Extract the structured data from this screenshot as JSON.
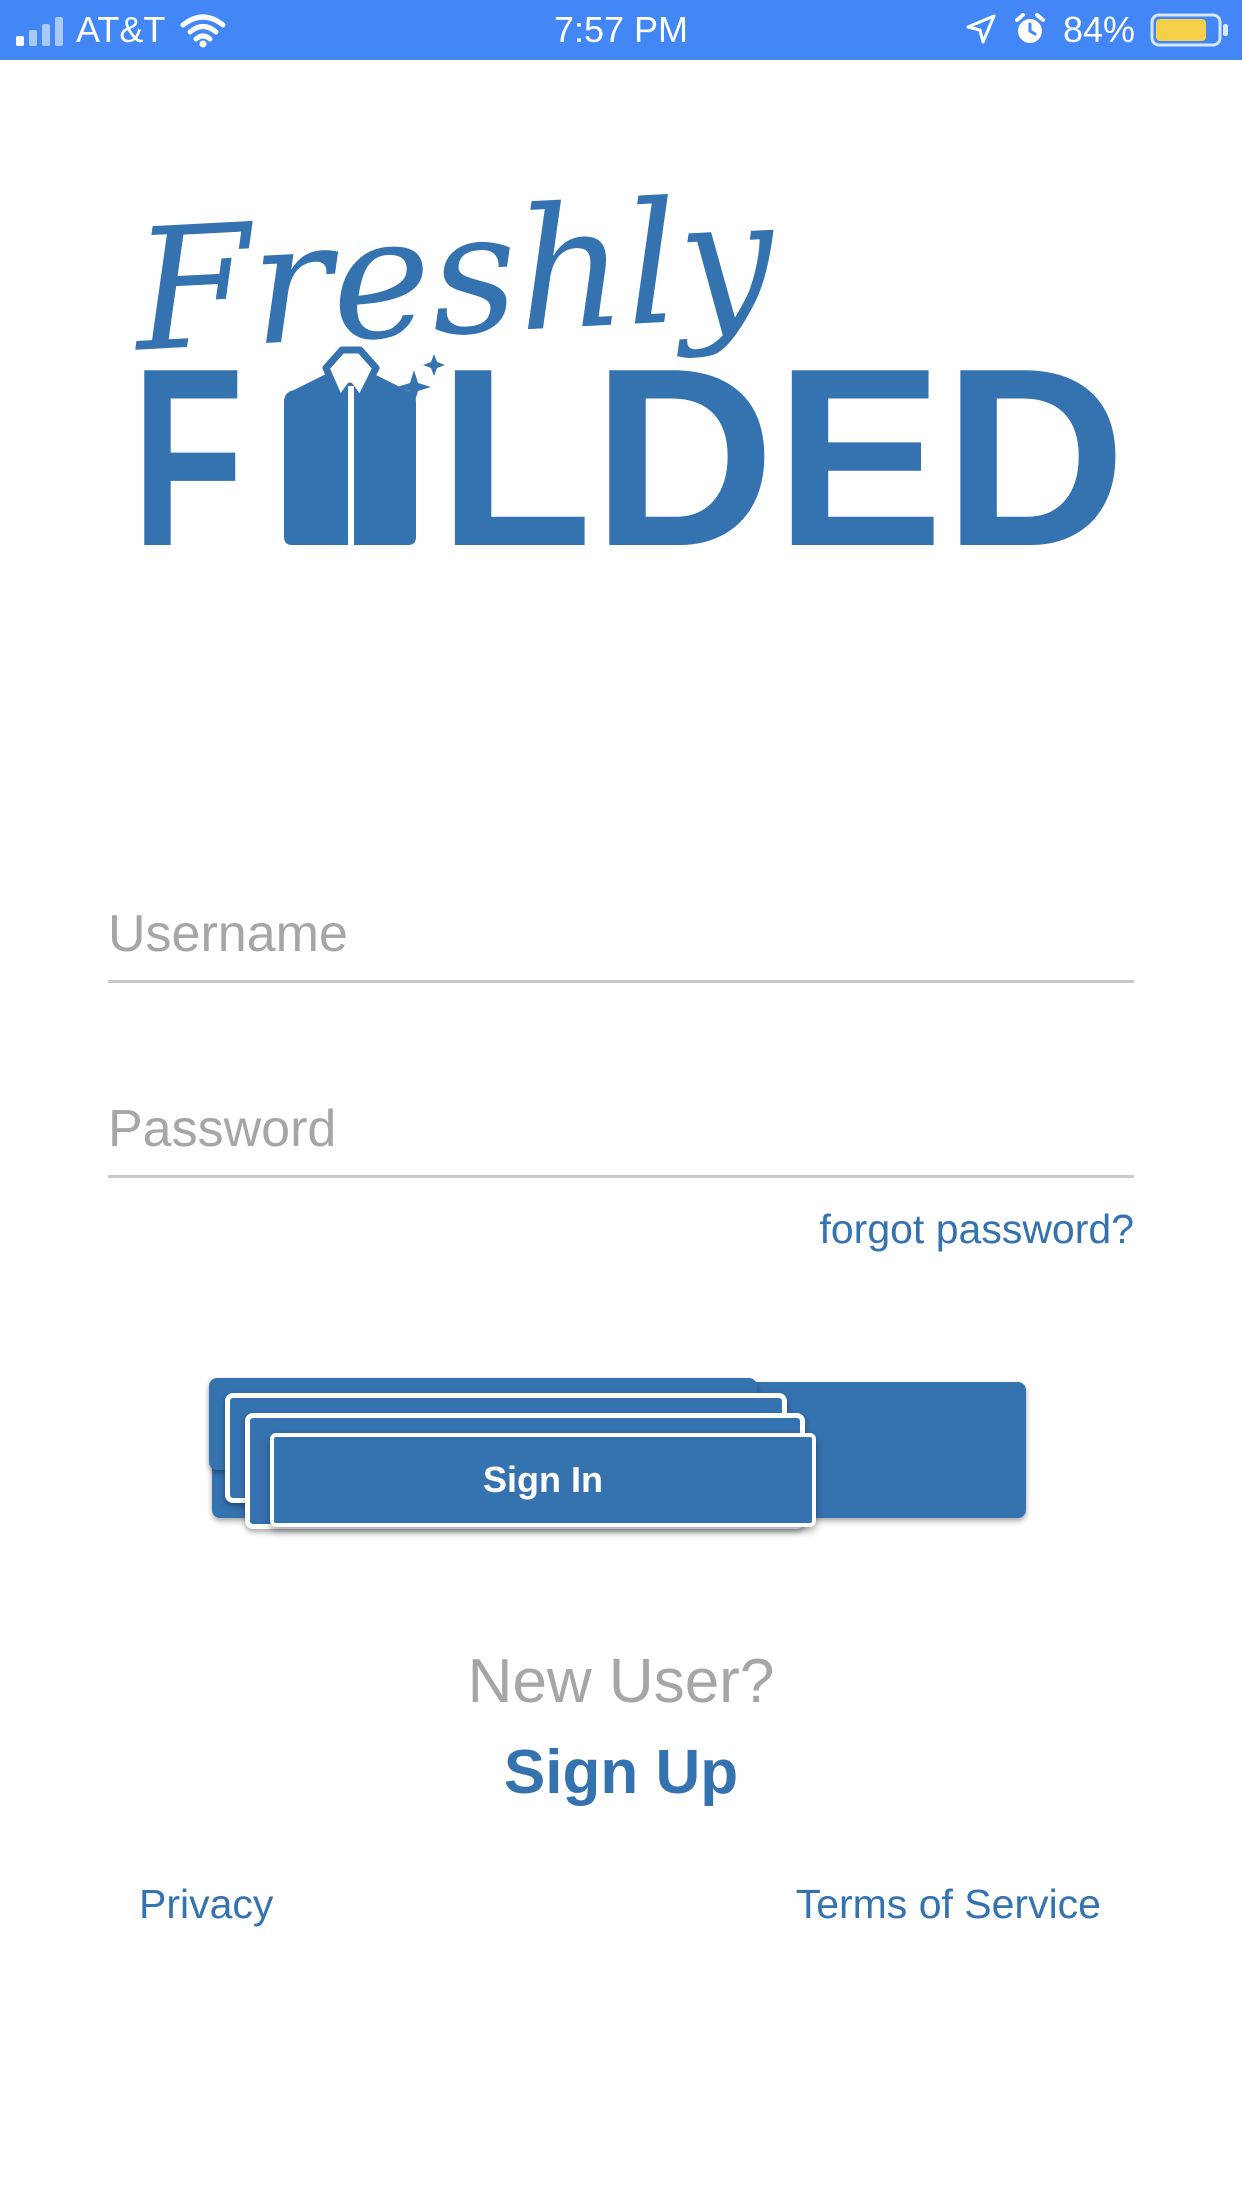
{
  "status_bar": {
    "carrier": "AT&T",
    "time": "7:57 PM",
    "battery_percent": "84%",
    "battery_level": 0.84,
    "background_color": "#4287f5",
    "icons": [
      "signal-icon",
      "wifi-icon",
      "location-arrow-icon",
      "alarm-icon",
      "battery-icon"
    ]
  },
  "logo": {
    "script_text": "Freshly",
    "block_text_parts": [
      "F",
      "LDED"
    ],
    "shirt_icon": "shirt-icon",
    "sparkle_icon": "sparkle-icon",
    "color": "#3572b0"
  },
  "form": {
    "username_placeholder": "Username",
    "username_value": "",
    "password_placeholder": "Password",
    "password_value": "",
    "forgot_password_label": "forgot password?",
    "sign_in_label": "Sign In"
  },
  "signup": {
    "prompt": "New User?",
    "link_label": "Sign Up"
  },
  "footer": {
    "privacy_label": "Privacy",
    "terms_label": "Terms of Service"
  },
  "colors": {
    "brand": "#3572b0",
    "placeholder": "#a6a6a6",
    "underline": "#c9c9c9"
  }
}
